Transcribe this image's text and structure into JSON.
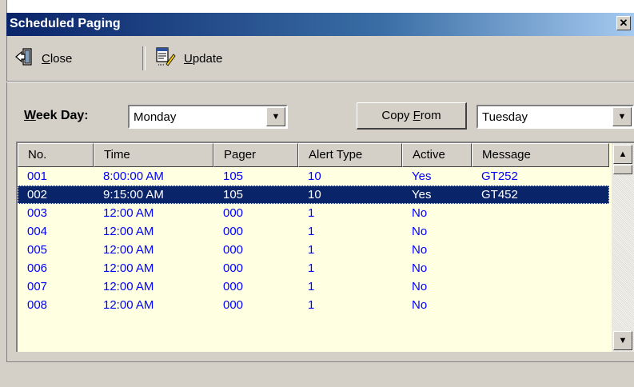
{
  "window": {
    "title": "Scheduled Paging"
  },
  "toolbar": {
    "close_label": "Close",
    "close_accel": "C",
    "update_label": "Update",
    "update_accel": "U"
  },
  "controls": {
    "weekday_label_accel": "W",
    "weekday_label_rest": "eek Day:",
    "weekday_value": "Monday",
    "copy_from_pre": "Copy ",
    "copy_from_accel": "F",
    "copy_from_rest": "rom",
    "copy_target_value": "Tuesday"
  },
  "table": {
    "columns": [
      "No.",
      "Time",
      "Pager",
      "Alert Type",
      "Active",
      "Message"
    ],
    "rows": [
      [
        "001",
        "8:00:00 AM",
        "105",
        "10",
        "Yes",
        "GT252"
      ],
      [
        "002",
        "9:15:00 AM",
        "105",
        "10",
        "Yes",
        "GT452"
      ],
      [
        "003",
        "12:00 AM",
        "000",
        "1",
        "No",
        ""
      ],
      [
        "004",
        "12:00 AM",
        "000",
        "1",
        "No",
        ""
      ],
      [
        "005",
        "12:00 AM",
        "000",
        "1",
        "No",
        ""
      ],
      [
        "006",
        "12:00 AM",
        "000",
        "1",
        "No",
        ""
      ],
      [
        "007",
        "12:00 AM",
        "000",
        "1",
        "No",
        ""
      ],
      [
        "008",
        "12:00 AM",
        "000",
        "1",
        "No",
        ""
      ]
    ],
    "selected_row": 1
  },
  "icons": {
    "close": "exit-door-icon",
    "update": "edit-document-icon",
    "window_close": "close-icon",
    "dropdown": "chevron-down-icon",
    "scroll_up": "arrow-up-icon",
    "scroll_down": "arrow-down-icon"
  },
  "colors": {
    "title_bar": "#0a246a",
    "row_text": "#0000ff",
    "row_bg": "#ffffe1",
    "selection": "#0a246a"
  }
}
